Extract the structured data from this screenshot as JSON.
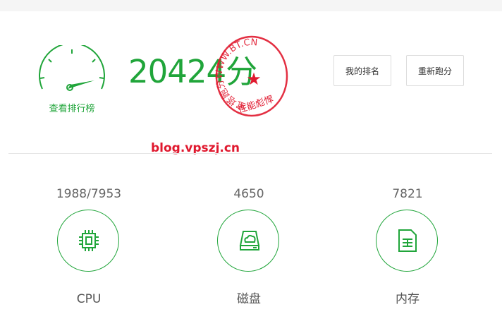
{
  "score": {
    "value": "20424",
    "unit": "分"
  },
  "gauge": {
    "label": "查看排行榜",
    "icon": "speedometer-icon"
  },
  "buttons": {
    "rank": "我的排名",
    "retest": "重新跑分"
  },
  "stamp": {
    "ring_text": "宝塔跑分WWW.BT.CN",
    "bottom_text": "性能彪悍",
    "star": "★"
  },
  "watermark": "blog.vpszj.cn",
  "metrics": [
    {
      "value": "1988/7953",
      "name": "CPU",
      "icon": "cpu-chip-icon"
    },
    {
      "value": "4650",
      "name": "磁盘",
      "icon": "disk-cloud-icon"
    },
    {
      "value": "7821",
      "name": "内存",
      "icon": "memory-card-icon"
    }
  ],
  "colors": {
    "accent": "#20a53a",
    "stamp": "#e0182e",
    "divider": "#e5e5e5"
  }
}
